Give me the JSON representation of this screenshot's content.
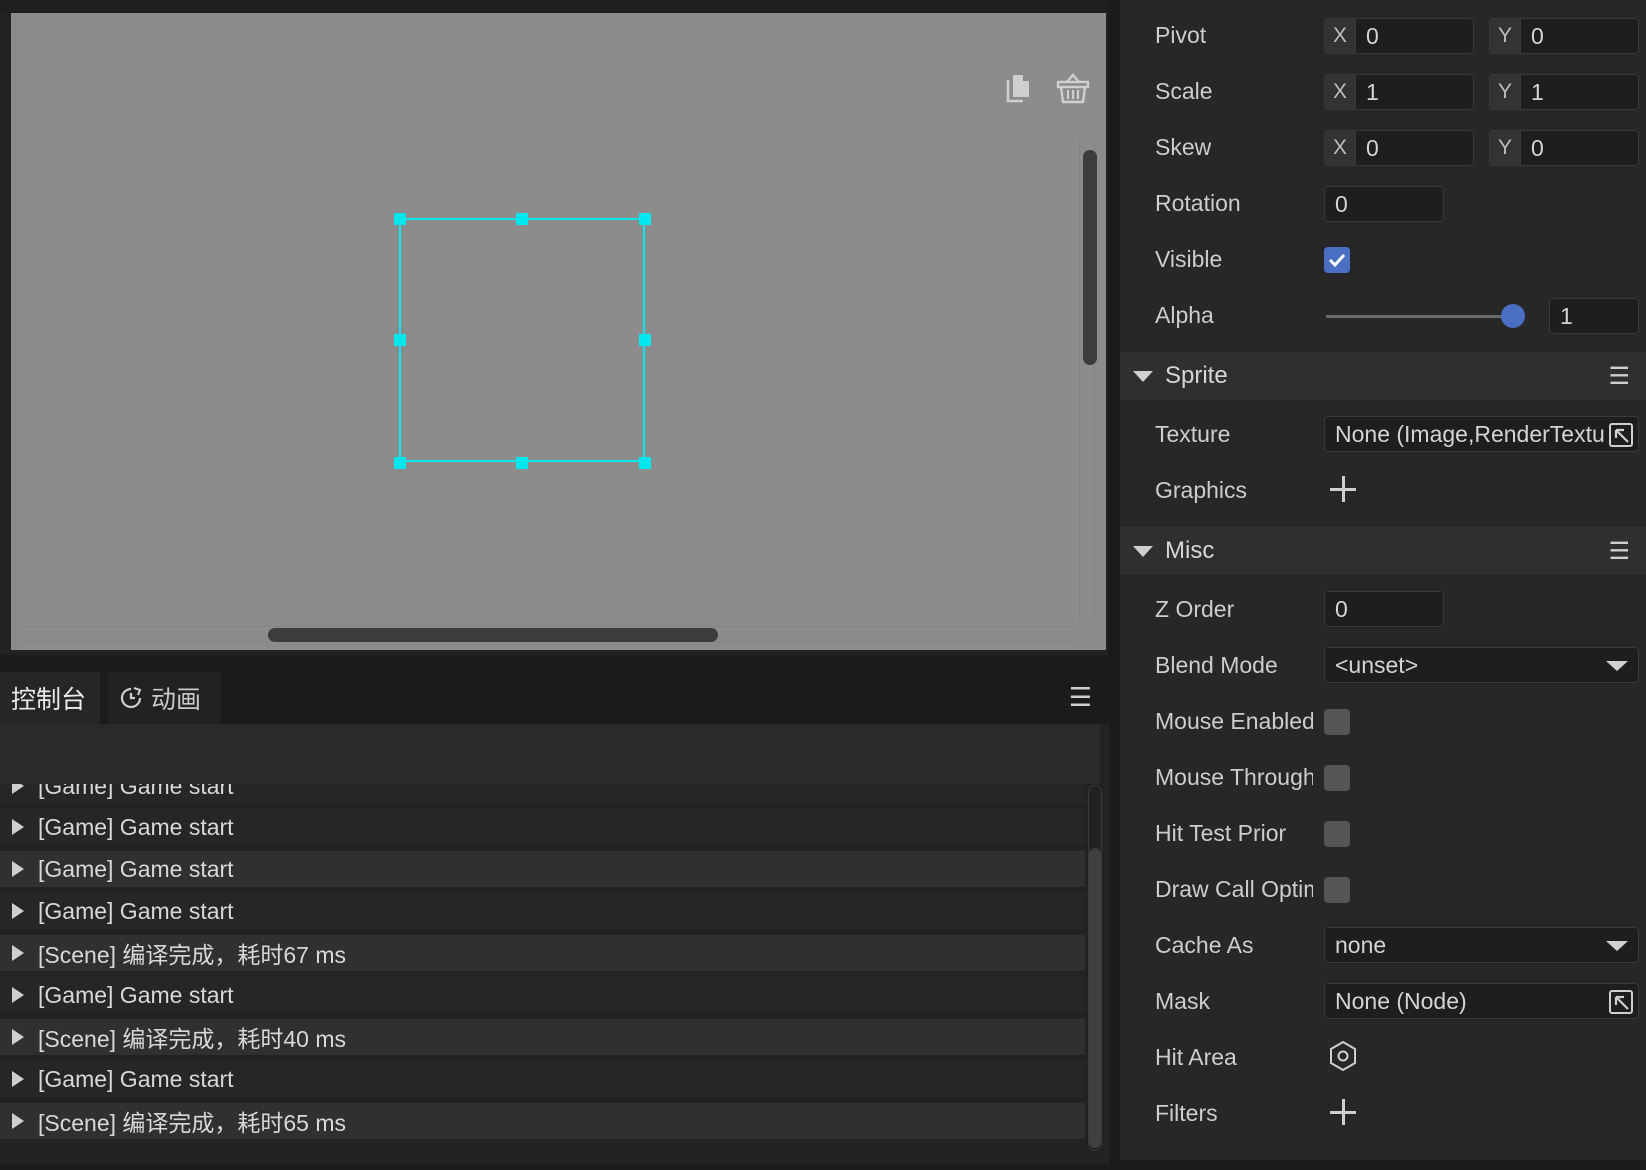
{
  "console": {
    "tabs": [
      {
        "label": "控制台",
        "icon": "console"
      },
      {
        "label": "动画",
        "icon": "clock-icon"
      }
    ],
    "menu_icon": "hamburger-icon",
    "toolbar_icons": [
      "copy-icon",
      "clear-basket-icon"
    ],
    "logs": [
      "[Game] Game start",
      "[Game] Game start",
      "[Game] Game start",
      "[Game] Game start",
      "[Scene] 编译完成，耗时67 ms",
      "[Game] Game start",
      "[Scene] 编译完成，耗时40 ms",
      "[Game] Game start",
      "[Scene] 编译完成，耗时65 ms"
    ]
  },
  "inspector": {
    "pivot": {
      "label": "Pivot",
      "x_axis": "X",
      "x": "0",
      "y_axis": "Y",
      "y": "0"
    },
    "scale": {
      "label": "Scale",
      "x_axis": "X",
      "x": "1",
      "y_axis": "Y",
      "y": "1"
    },
    "skew": {
      "label": "Skew",
      "x_axis": "X",
      "x": "0",
      "y_axis": "Y",
      "y": "0"
    },
    "rotation": {
      "label": "Rotation",
      "value": "0"
    },
    "visible": {
      "label": "Visible",
      "checked": true
    },
    "alpha": {
      "label": "Alpha",
      "value": "1",
      "slider_fraction": 1.0
    },
    "sprite": {
      "title": "Sprite",
      "texture": {
        "label": "Texture",
        "value": "None (Image,RenderTexture)"
      },
      "graphics": {
        "label": "Graphics"
      }
    },
    "misc": {
      "title": "Misc",
      "z_order": {
        "label": "Z Order",
        "value": "0"
      },
      "blend_mode": {
        "label": "Blend Mode",
        "value": "<unset>"
      },
      "mouse_enabled": {
        "label": "Mouse Enabled",
        "checked": false
      },
      "mouse_through": {
        "label": "Mouse Through",
        "checked": false
      },
      "hit_test_prior": {
        "label": "Hit Test Prior",
        "checked": false
      },
      "draw_call_opti": {
        "label": "Draw Call Optimize",
        "checked": false
      },
      "cache_as": {
        "label": "Cache As",
        "value": "none"
      },
      "mask": {
        "label": "Mask",
        "value": "None (Node)"
      },
      "hit_area": {
        "label": "Hit Area",
        "icon": "hexagon-icon"
      },
      "filters": {
        "label": "Filters"
      }
    }
  },
  "colors": {
    "selection": "#00e8ee",
    "checkbox_on": "#4b6fc2",
    "canvas": "#8c8c8c",
    "panel": "#272727"
  }
}
